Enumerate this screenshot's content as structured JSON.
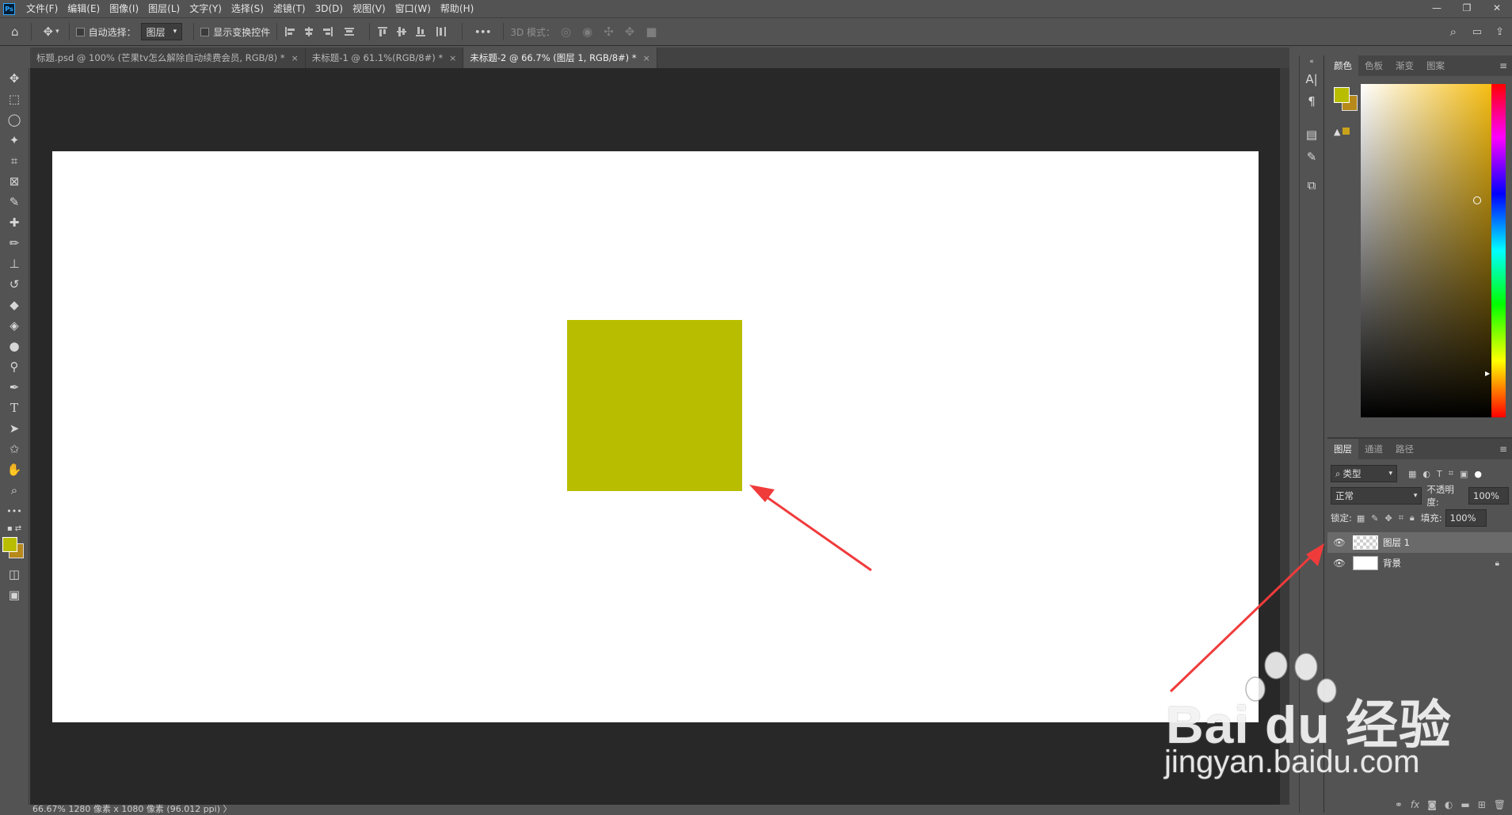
{
  "app": {
    "logo": "Ps"
  },
  "menu": [
    "文件(F)",
    "编辑(E)",
    "图像(I)",
    "图层(L)",
    "文字(Y)",
    "选择(S)",
    "滤镜(T)",
    "3D(D)",
    "视图(V)",
    "窗口(W)",
    "帮助(H)"
  ],
  "window_controls": {
    "minimize": "—",
    "restore": "❐",
    "close": "✕"
  },
  "options_bar": {
    "auto_select_label": "自动选择：",
    "auto_select_value": "图层",
    "show_transform_label": "显示变换控件",
    "more": "•••",
    "mode_3d_label": "3D 模式："
  },
  "tabs": [
    {
      "label": "标题.psd @ 100% (芒果tv怎么解除自动续费会员, RGB/8) *",
      "active": false
    },
    {
      "label": "未标题-1 @ 61.1%(RGB/8#) *",
      "active": false
    },
    {
      "label": "未标题-2 @ 66.7% (图层 1, RGB/8#) *",
      "active": true
    }
  ],
  "tab_close": "×",
  "status": {
    "text": "66.67%   1280 像素 x 1080 像素 (96.012 ppi)  〉"
  },
  "color_panel": {
    "tabs": [
      "颜色",
      "色板",
      "渐变",
      "图案"
    ],
    "foreground": "#b9bd00",
    "background": "#b7891a"
  },
  "layers_panel": {
    "tabs": [
      "图层",
      "通道",
      "路径"
    ],
    "filter_label": "类型",
    "blend_mode": "正常",
    "opacity_label": "不透明度:",
    "opacity_value": "100%",
    "lock_label": "锁定:",
    "fill_label": "填充:",
    "fill_value": "100%",
    "layers": [
      {
        "name": "图层 1",
        "selected": true,
        "locked": false
      },
      {
        "name": "背景",
        "selected": false,
        "locked": true
      }
    ],
    "footer_icons": [
      "link-icon",
      "fx-icon",
      "mask-icon",
      "adjustment-icon",
      "group-icon",
      "new-layer-icon",
      "trash-icon"
    ]
  },
  "canvas": {
    "square_color": "#b9bd00",
    "arrow_color": "#f03b3b"
  },
  "watermark": {
    "brand": "Bai du 经验",
    "url": "jingyan.baidu.com"
  }
}
